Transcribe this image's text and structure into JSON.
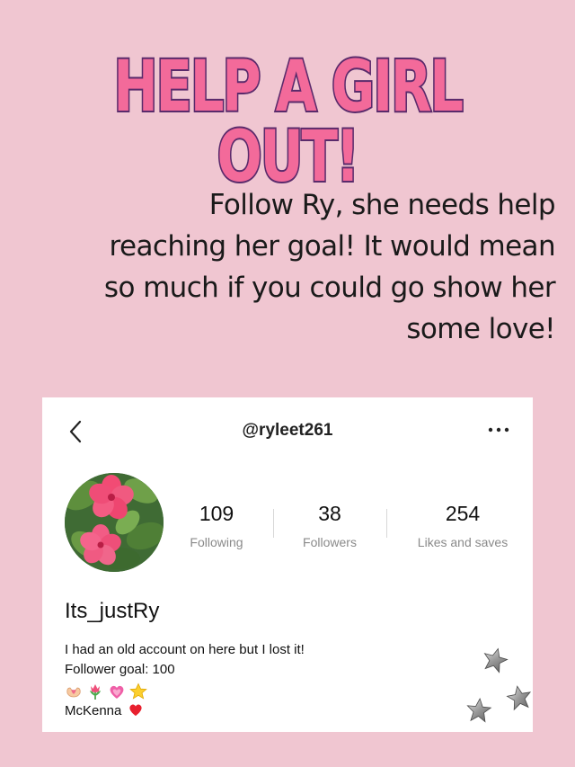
{
  "headline": "HELP A GIRL OUT!",
  "message": {
    "lines": [
      "Follow Ry, she needs help",
      "reaching her goal! It would mean",
      "so much if you could go show her",
      "some love!"
    ]
  },
  "profile": {
    "handle": "@ryleet261",
    "display_name": "Its_justRy",
    "stats": [
      {
        "value": "109",
        "label": "Following"
      },
      {
        "value": "38",
        "label": "Followers"
      },
      {
        "value": "254",
        "label": "Likes and saves"
      }
    ],
    "bio": {
      "line1": "I had an old account on here but I lost it!",
      "line2": "Follower goal: 100",
      "emojis": [
        "hands-heart-icon",
        "tulip-icon",
        "sparkling-heart-icon",
        "star-icon"
      ],
      "line4": "McKenna"
    }
  },
  "icons": {
    "back": "chevron-left-icon",
    "more": "more-horizontal-icon",
    "avatar": "hibiscus-flower-photo"
  },
  "colors": {
    "background": "#f0c6d1",
    "headline_fill": "#f36a9a",
    "headline_outline": "#5a2a6b"
  }
}
